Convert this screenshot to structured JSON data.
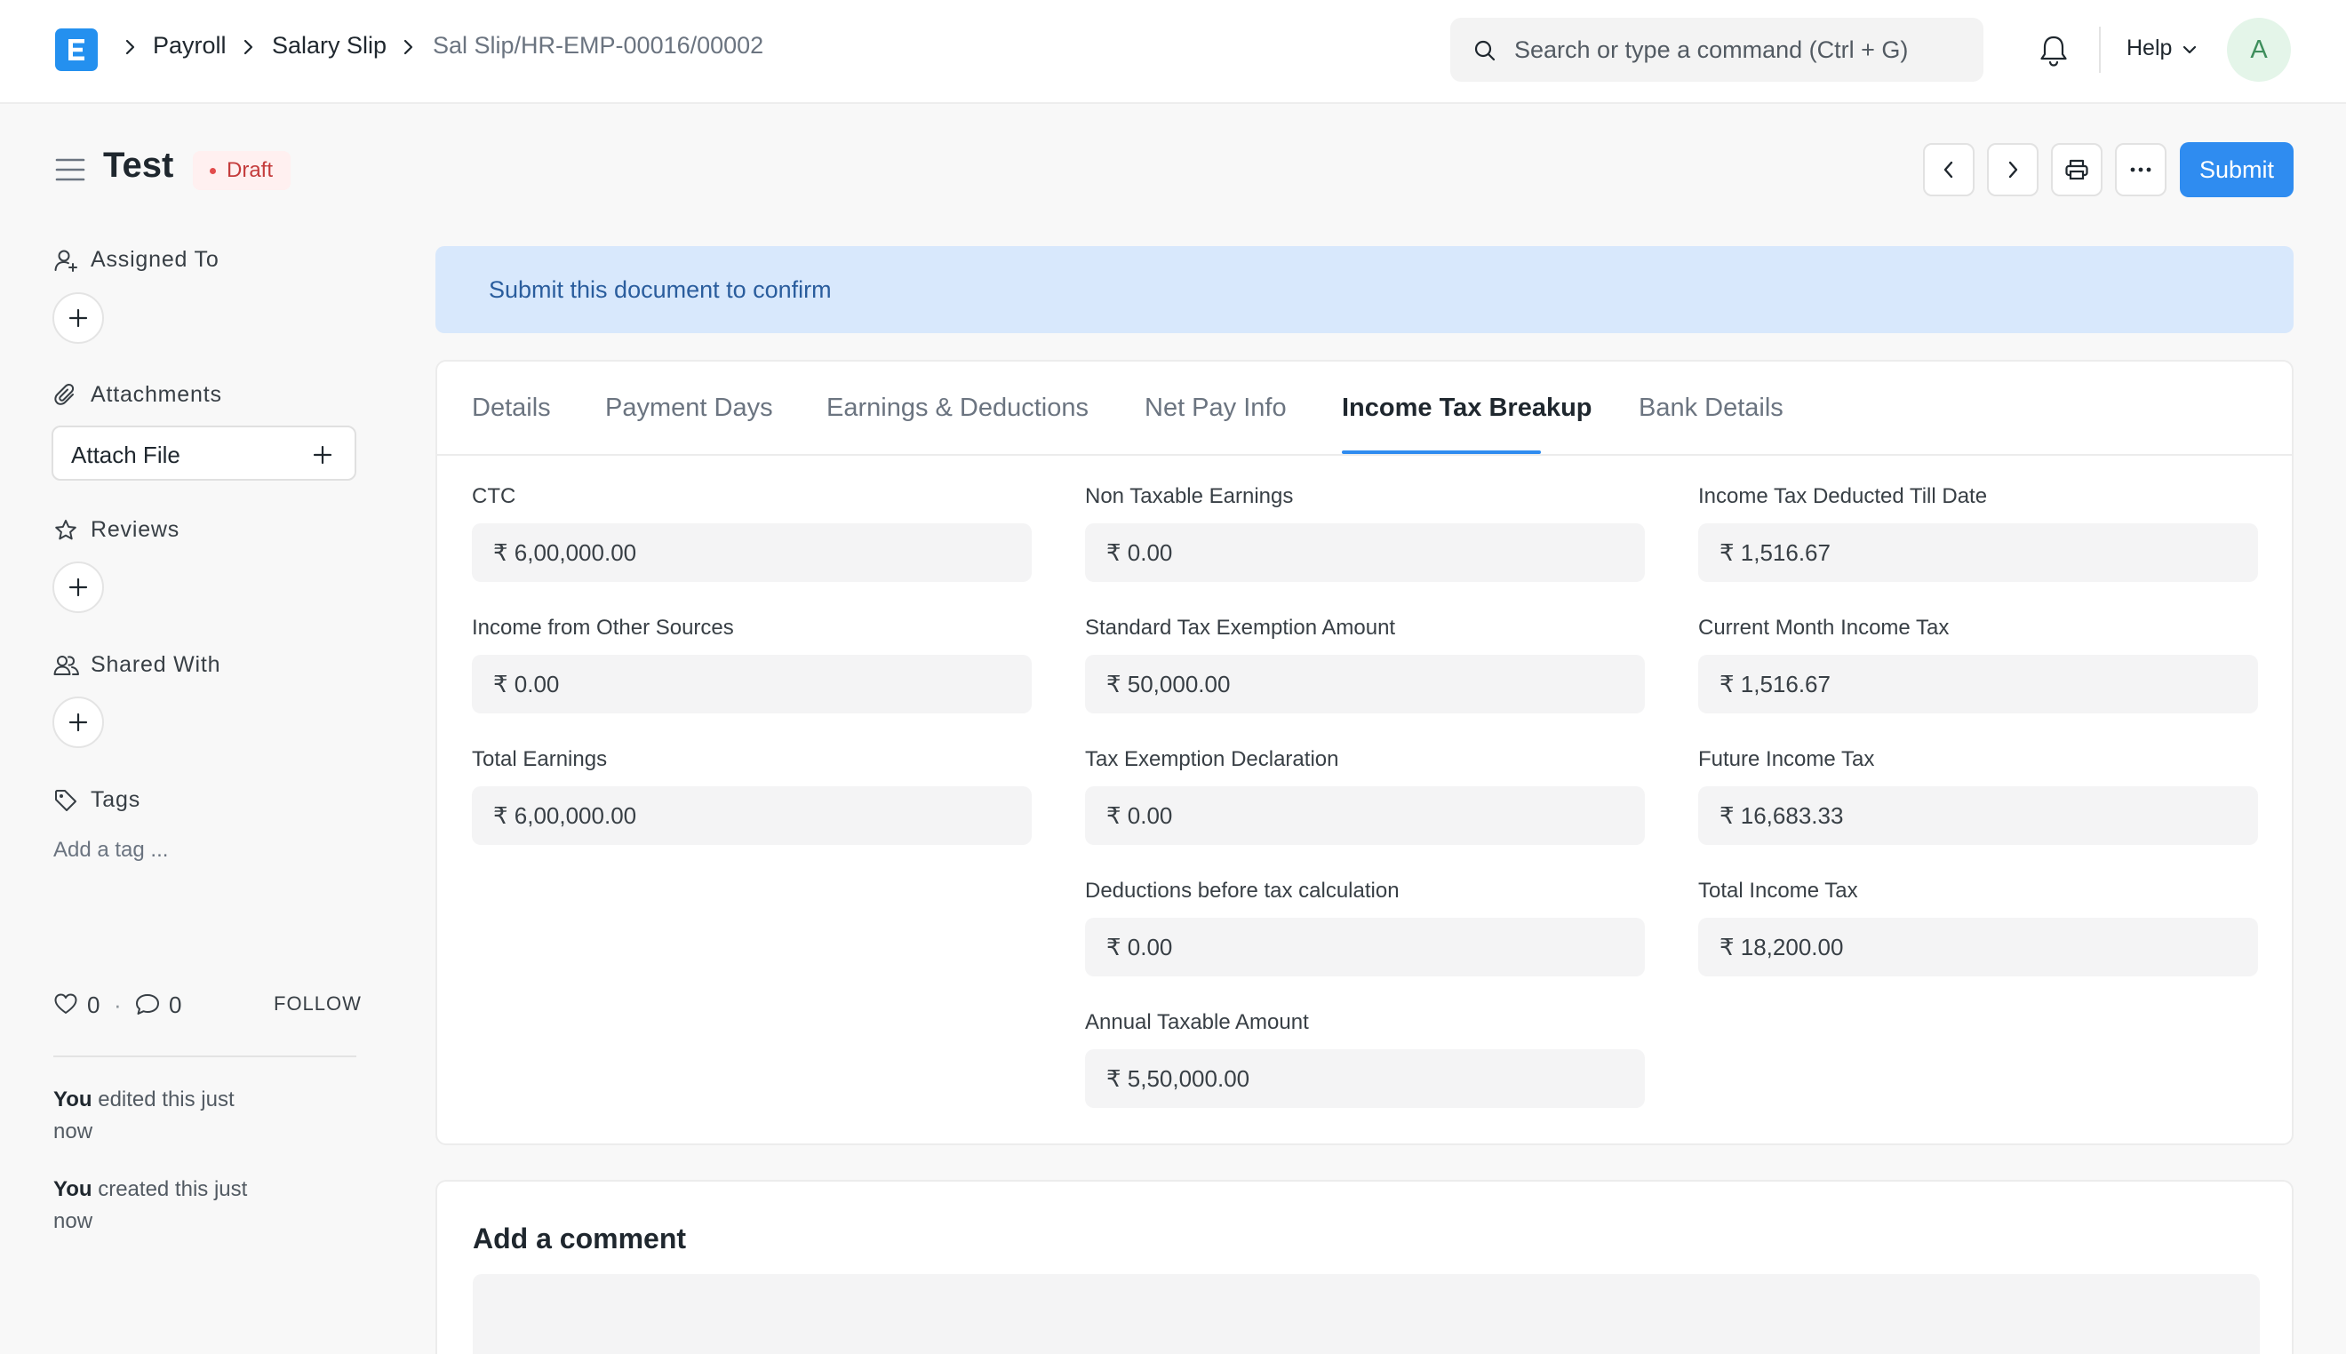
{
  "navbar": {
    "logo_letter": "E",
    "breadcrumbs": [
      "Payroll",
      "Salary Slip",
      "Sal Slip/HR-EMP-00016/00002"
    ],
    "search_placeholder": "Search or type a command (Ctrl + G)",
    "help_label": "Help",
    "avatar_initial": "A"
  },
  "page": {
    "title": "Test",
    "status": "Draft",
    "submit_label": "Submit"
  },
  "sidebar": {
    "assigned_to": "Assigned To",
    "attachments": "Attachments",
    "attach_file": "Attach File",
    "reviews": "Reviews",
    "shared_with": "Shared With",
    "tags": "Tags",
    "add_tag": "Add a tag ...",
    "likes": "0",
    "comments": "0",
    "follow": "FOLLOW",
    "activity": [
      {
        "user": "You",
        "text": " edited this just now"
      },
      {
        "user": "You",
        "text": " created this just now"
      }
    ]
  },
  "banner": {
    "text": "Submit this document to confirm"
  },
  "tabs": [
    "Details",
    "Payment Days",
    "Earnings & Deductions",
    "Net Pay Info",
    "Income Tax Breakup",
    "Bank Details"
  ],
  "active_tab": "Income Tax Breakup",
  "fields": {
    "col1": [
      {
        "label": "CTC",
        "value": "₹ 6,00,000.00"
      },
      {
        "label": "Income from Other Sources",
        "value": "₹ 0.00"
      },
      {
        "label": "Total Earnings",
        "value": "₹ 6,00,000.00"
      }
    ],
    "col2": [
      {
        "label": "Non Taxable Earnings",
        "value": "₹ 0.00"
      },
      {
        "label": "Standard Tax Exemption Amount",
        "value": "₹ 50,000.00"
      },
      {
        "label": "Tax Exemption Declaration",
        "value": "₹ 0.00"
      },
      {
        "label": "Deductions before tax calculation",
        "value": "₹ 0.00"
      },
      {
        "label": "Annual Taxable Amount",
        "value": "₹ 5,50,000.00"
      }
    ],
    "col3": [
      {
        "label": "Income Tax Deducted Till Date",
        "value": "₹ 1,516.67"
      },
      {
        "label": "Current Month Income Tax",
        "value": "₹ 1,516.67"
      },
      {
        "label": "Future Income Tax",
        "value": "₹ 16,683.33"
      },
      {
        "label": "Total Income Tax",
        "value": "₹ 18,200.00"
      }
    ]
  },
  "comment": {
    "title": "Add a comment"
  },
  "icons": [
    "search-icon",
    "bell-icon",
    "chevron-down-icon",
    "hamburger-icon",
    "chevron-left-icon",
    "chevron-right-icon",
    "printer-icon",
    "more-icon",
    "user-icon",
    "paperclip-icon",
    "star-icon",
    "users-icon",
    "tag-icon",
    "heart-icon",
    "comment-icon",
    "plus-icon"
  ],
  "colors": {
    "primary": "#2f8cf0",
    "banner_bg": "#d8e8fc",
    "draft_red": "#c43c3c"
  }
}
